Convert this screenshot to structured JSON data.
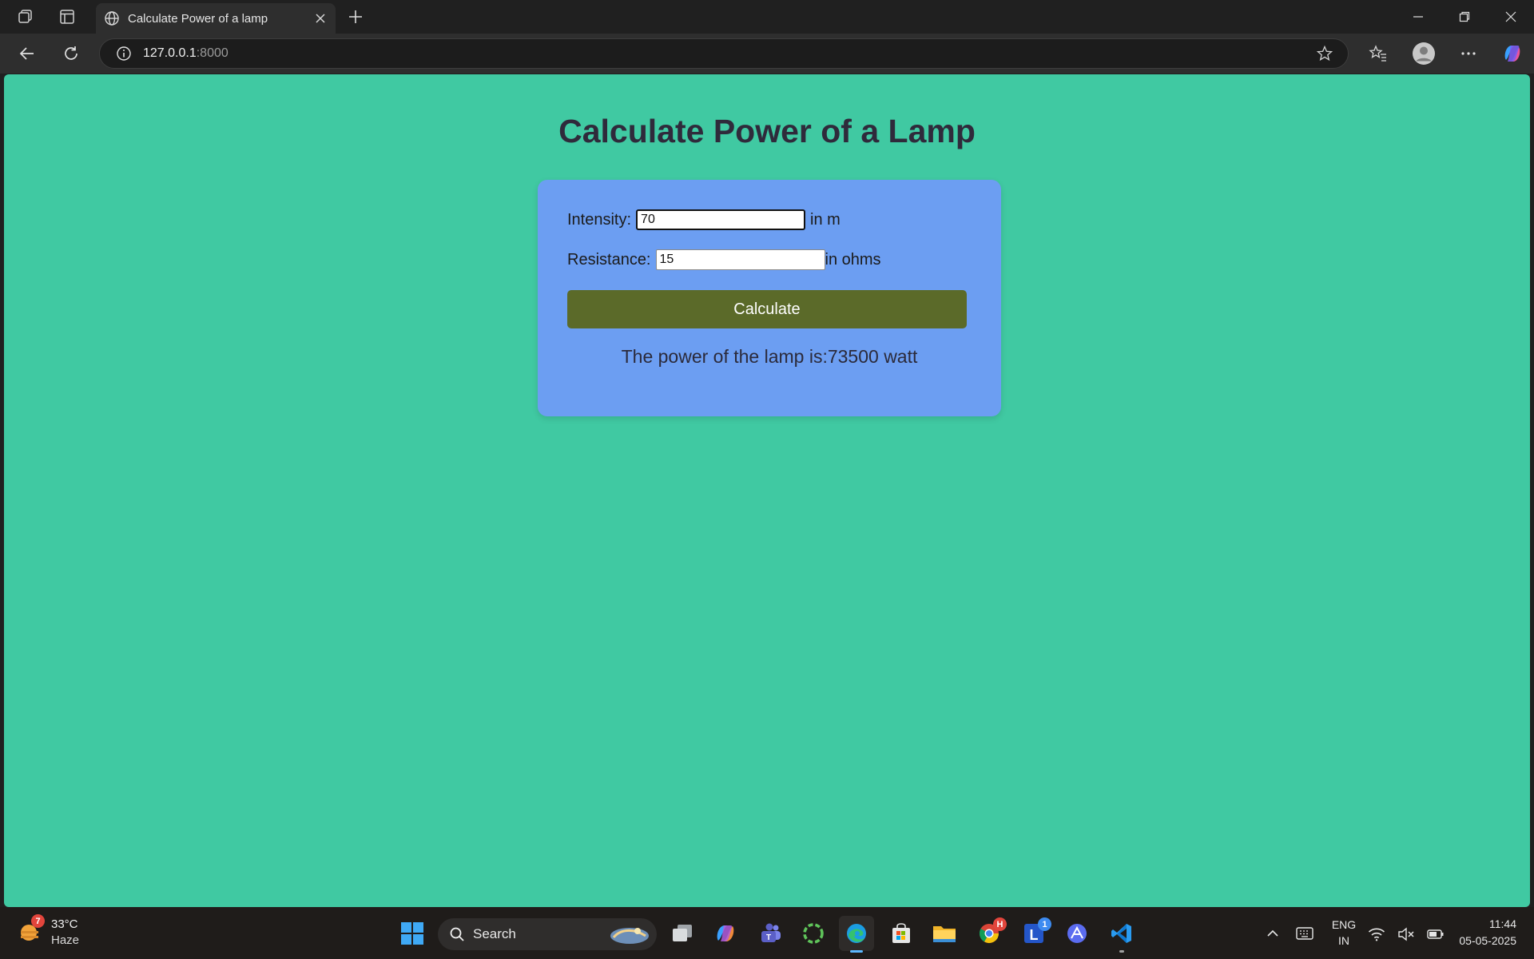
{
  "browser": {
    "tab_title": "Calculate Power of a lamp",
    "url_host": "127.0.0.1",
    "url_port": ":8000"
  },
  "page": {
    "title": "Calculate Power of a Lamp",
    "intensity_label": "Intensity:",
    "intensity_value": "70",
    "intensity_unit": "in m",
    "resistance_label": "Resistance:",
    "resistance_value": "15",
    "resistance_unit": "in ohms",
    "calculate_label": "Calculate",
    "result_text": "The power of the lamp is:73500 watt"
  },
  "taskbar": {
    "weather_temp": "33°C",
    "weather_desc": "Haze",
    "weather_badge": "7",
    "search_label": "Search",
    "chrome_badge": "H",
    "l_app_badge": "1",
    "lang_top": "ENG",
    "lang_bottom": "IN",
    "time": "11:44",
    "date": "05-05-2025"
  },
  "colors": {
    "page_bg": "#40c9a2",
    "card_bg": "#6c9ef2",
    "button_bg": "#5b6a29",
    "title_color": "#2f2a3b"
  }
}
